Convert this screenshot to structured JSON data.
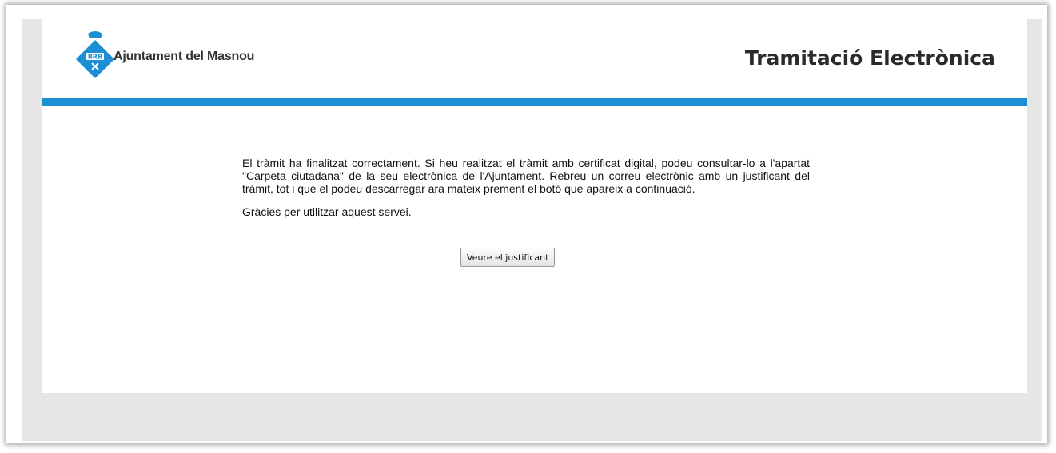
{
  "header": {
    "org_name": "Ajuntament del Masnou",
    "app_title": "Tramitació Electrònica",
    "logo_icon": "masnou-coat-of-arms-icon",
    "accent_color": "#1c8fd4"
  },
  "main": {
    "message": "El tràmit ha finalitzat correctament. Si heu realitzat el tràmit amb certificat digital, podeu consultar-lo a l'apartat \"Carpeta ciutadana\" de la seu electrònica de l'Ajuntament. Rebreu un correu electrònic amb un justificant del tràmit, tot i que el podeu descarregar ara mateix prement el botó que apareix a continuació.",
    "thanks": "Gràcies per utilitzar aquest servei.",
    "receipt_button_label": "Veure el justificant"
  }
}
